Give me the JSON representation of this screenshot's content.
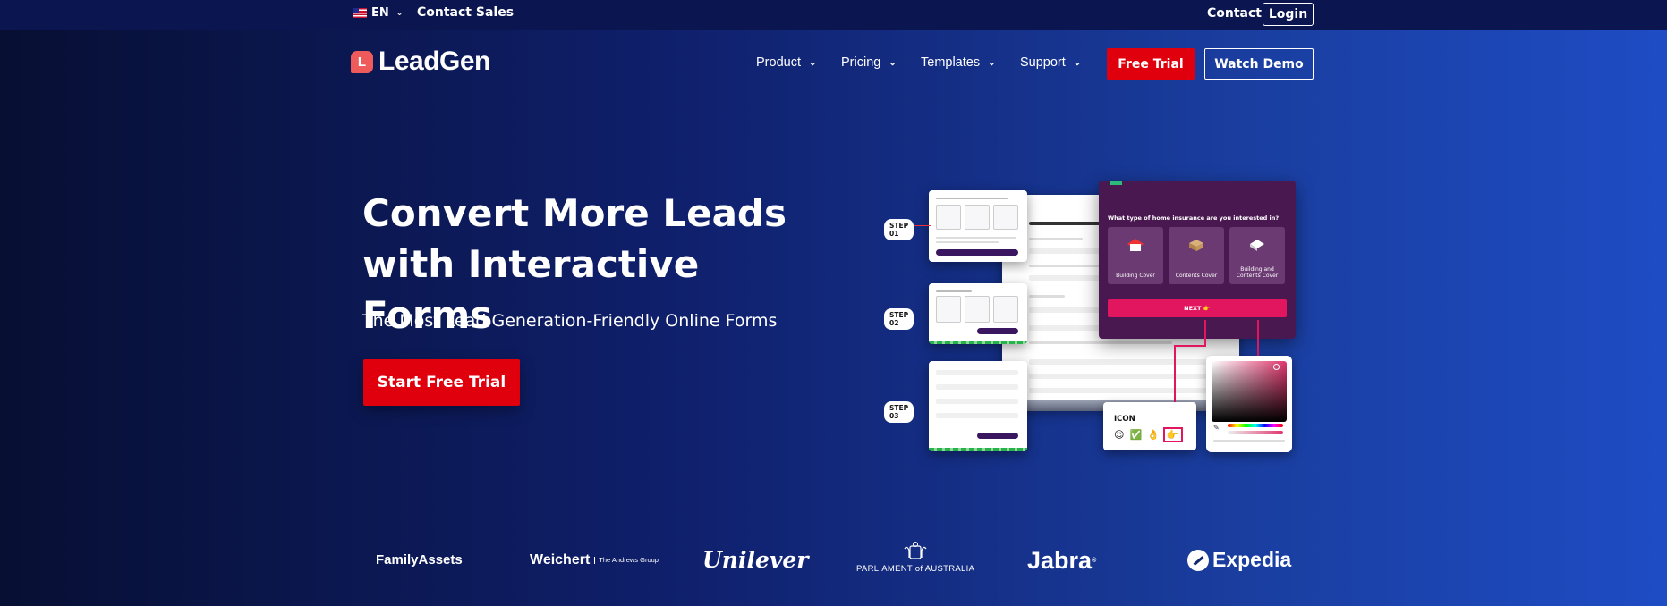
{
  "topbar": {
    "language": "EN",
    "contact_sales": "Contact Sales",
    "contact": "Contact",
    "login": "Login"
  },
  "brand": {
    "logo_letter": "L",
    "name": "LeadGen"
  },
  "nav": {
    "items": [
      {
        "label": "Product"
      },
      {
        "label": "Pricing"
      },
      {
        "label": "Templates"
      },
      {
        "label": "Support"
      }
    ],
    "free_trial": "Free Trial",
    "watch_demo": "Watch Demo"
  },
  "hero": {
    "headline_line1": "Convert More Leads",
    "headline_line2": "with Interactive Forms",
    "subheadline": "The Most Lead Generation-Friendly Online Forms",
    "cta": "Start Free Trial"
  },
  "illustration": {
    "steps": [
      "STEP 01",
      "STEP 02",
      "STEP 03"
    ],
    "question": "What type of home insurance are you interested in?",
    "options": [
      "Building Cover",
      "Contents Cover",
      "Building and Contents Cover"
    ],
    "next_label": "NEXT 👉",
    "icon_card_label": "ICON",
    "icon_emojis": [
      "😌",
      "✅",
      "👌",
      "👉"
    ]
  },
  "logos": {
    "familyassets": "FamilyAssets",
    "weichert": "Weichert",
    "weichert_sub": "The Andrews Group",
    "unilever": "Unilever",
    "parliament": "PARLIAMENT of AUSTRALIA",
    "jabra": "Jabra",
    "expedia": "Expedia"
  },
  "colors": {
    "accent_red": "#e0000d",
    "hero_dark": "#070f33",
    "hero_light": "#1e4cc4",
    "form_purple": "#4a1850",
    "form_pink": "#e2165e"
  }
}
